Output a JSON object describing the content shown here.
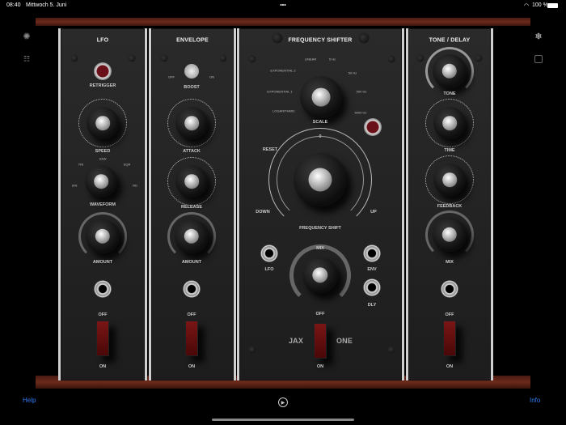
{
  "status": {
    "time": "08:40",
    "date": "Mittwoch 5. Juni",
    "dots": "•••",
    "battery": "100 %"
  },
  "lfo": {
    "title": "LFO",
    "retrigger": "RETRIGGER",
    "speed": "SPEED",
    "waveform": "WAVEFORM",
    "wave_options": [
      "TRI",
      "SAW",
      "SQR",
      "SIN",
      "RD"
    ],
    "amount": "AMOUNT",
    "off": "OFF",
    "on": "ON"
  },
  "envelope": {
    "title": "ENVELOPE",
    "boost_off": "OFF",
    "boost_on": "ON",
    "boost": "BOOST",
    "attack": "ATTACK",
    "release": "RELEASE",
    "amount": "AMOUNT",
    "off": "OFF",
    "on": "ON"
  },
  "shifter": {
    "title": "FREQUENCY SHIFTER",
    "scale": "SCALE",
    "scale_options": [
      "LINEAR",
      "5 Hz",
      "EXPONENTIAL 2",
      "50 Hz",
      "EXPONENTIAL 1",
      "500 Hz",
      "LOGARITHMIC",
      "5000 Hz"
    ],
    "reset": "RESET",
    "zero": "0",
    "down": "DOWN",
    "up": "UP",
    "freq_shift": "FREQUENCY SHIFT",
    "lfo": "LFO",
    "env": "ENV",
    "mix": "MIX",
    "dly": "DLY",
    "off": "OFF",
    "on": "ON",
    "brand1": "JAX",
    "brand2": "ONE"
  },
  "tone_delay": {
    "title": "TONE / DELAY",
    "tone": "TONE",
    "time": "TIME",
    "feedback": "FEEDBACK",
    "mix": "MIX",
    "off": "OFF",
    "on": "ON"
  },
  "footer": {
    "help": "Help",
    "info": "Info",
    "play": "▶"
  }
}
